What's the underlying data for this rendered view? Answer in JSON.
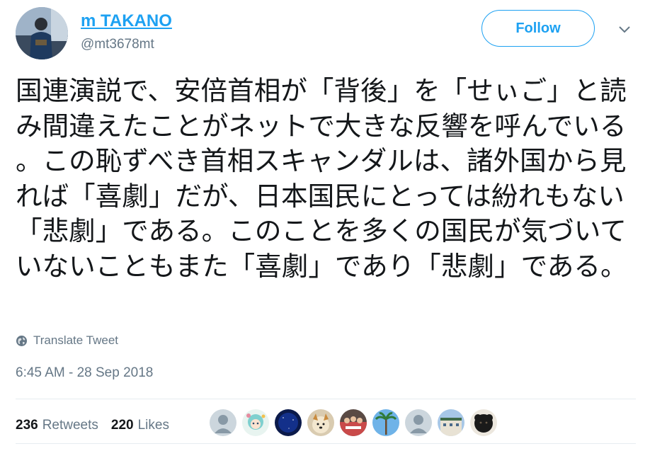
{
  "user": {
    "display_name": "m TAKANO",
    "screen_name": "@mt3678mt"
  },
  "follow_label": "Follow",
  "tweet": {
    "text": "国連演説で、安倍首相が「背後」を「せぃご」と読み間違えたことがネットで大きな反響を呼んでいる。この恥ずべき首相スキャンダルは、諸外国から見れば「喜劇」だが、日本国民にとっては紛れもない「悲劇」である。このことを多くの国民が気づいていないこともまた「喜劇」であり「悲劇」である。",
    "translate_label": "Translate Tweet",
    "timestamp": "6:45 AM - 28 Sep 2018"
  },
  "stats": {
    "retweets_count": "236",
    "retweets_label": "Retweets",
    "likes_count": "220",
    "likes_label": "Likes"
  },
  "icons": {
    "caret": "chevron-down-icon",
    "translate": "globe-icon"
  },
  "colors": {
    "accent": "#1da1f2",
    "secondary_text": "#657786",
    "primary_text": "#14171a",
    "divider": "#e6ecf0"
  }
}
